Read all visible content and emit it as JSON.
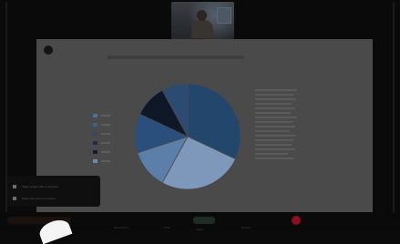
{
  "meeting": {
    "slide": {
      "title": "",
      "legend": [
        {
          "name": "",
          "color": "#4a6f9a"
        },
        {
          "name": "",
          "color": "#3b5f86"
        },
        {
          "name": "",
          "color": "#2d4a69"
        },
        {
          "name": "",
          "color": "#1c2f46"
        },
        {
          "name": "",
          "color": "#0f1f31"
        },
        {
          "name": "",
          "color": "#6d8cb3"
        }
      ],
      "pie_slices": [
        {
          "color": "#23466d",
          "value": 32
        },
        {
          "color": "#7e98bb",
          "value": 26
        },
        {
          "color": "#5c7fa9",
          "value": 12
        },
        {
          "color": "#2a4f7c",
          "value": 12
        },
        {
          "color": "#0f1826",
          "value": 10
        },
        {
          "color": "#2b4b72",
          "value": 8
        }
      ]
    },
    "menu": {
      "item1": "Share screen with a computer",
      "item2": "Share from Zoom on phone"
    },
    "toolbar": {
      "items": [
        "Participants",
        "Chat",
        "Share",
        "Record"
      ]
    },
    "colors": {
      "end_call": "#8b0f1f",
      "share_highlight": "#1e2d22"
    }
  }
}
